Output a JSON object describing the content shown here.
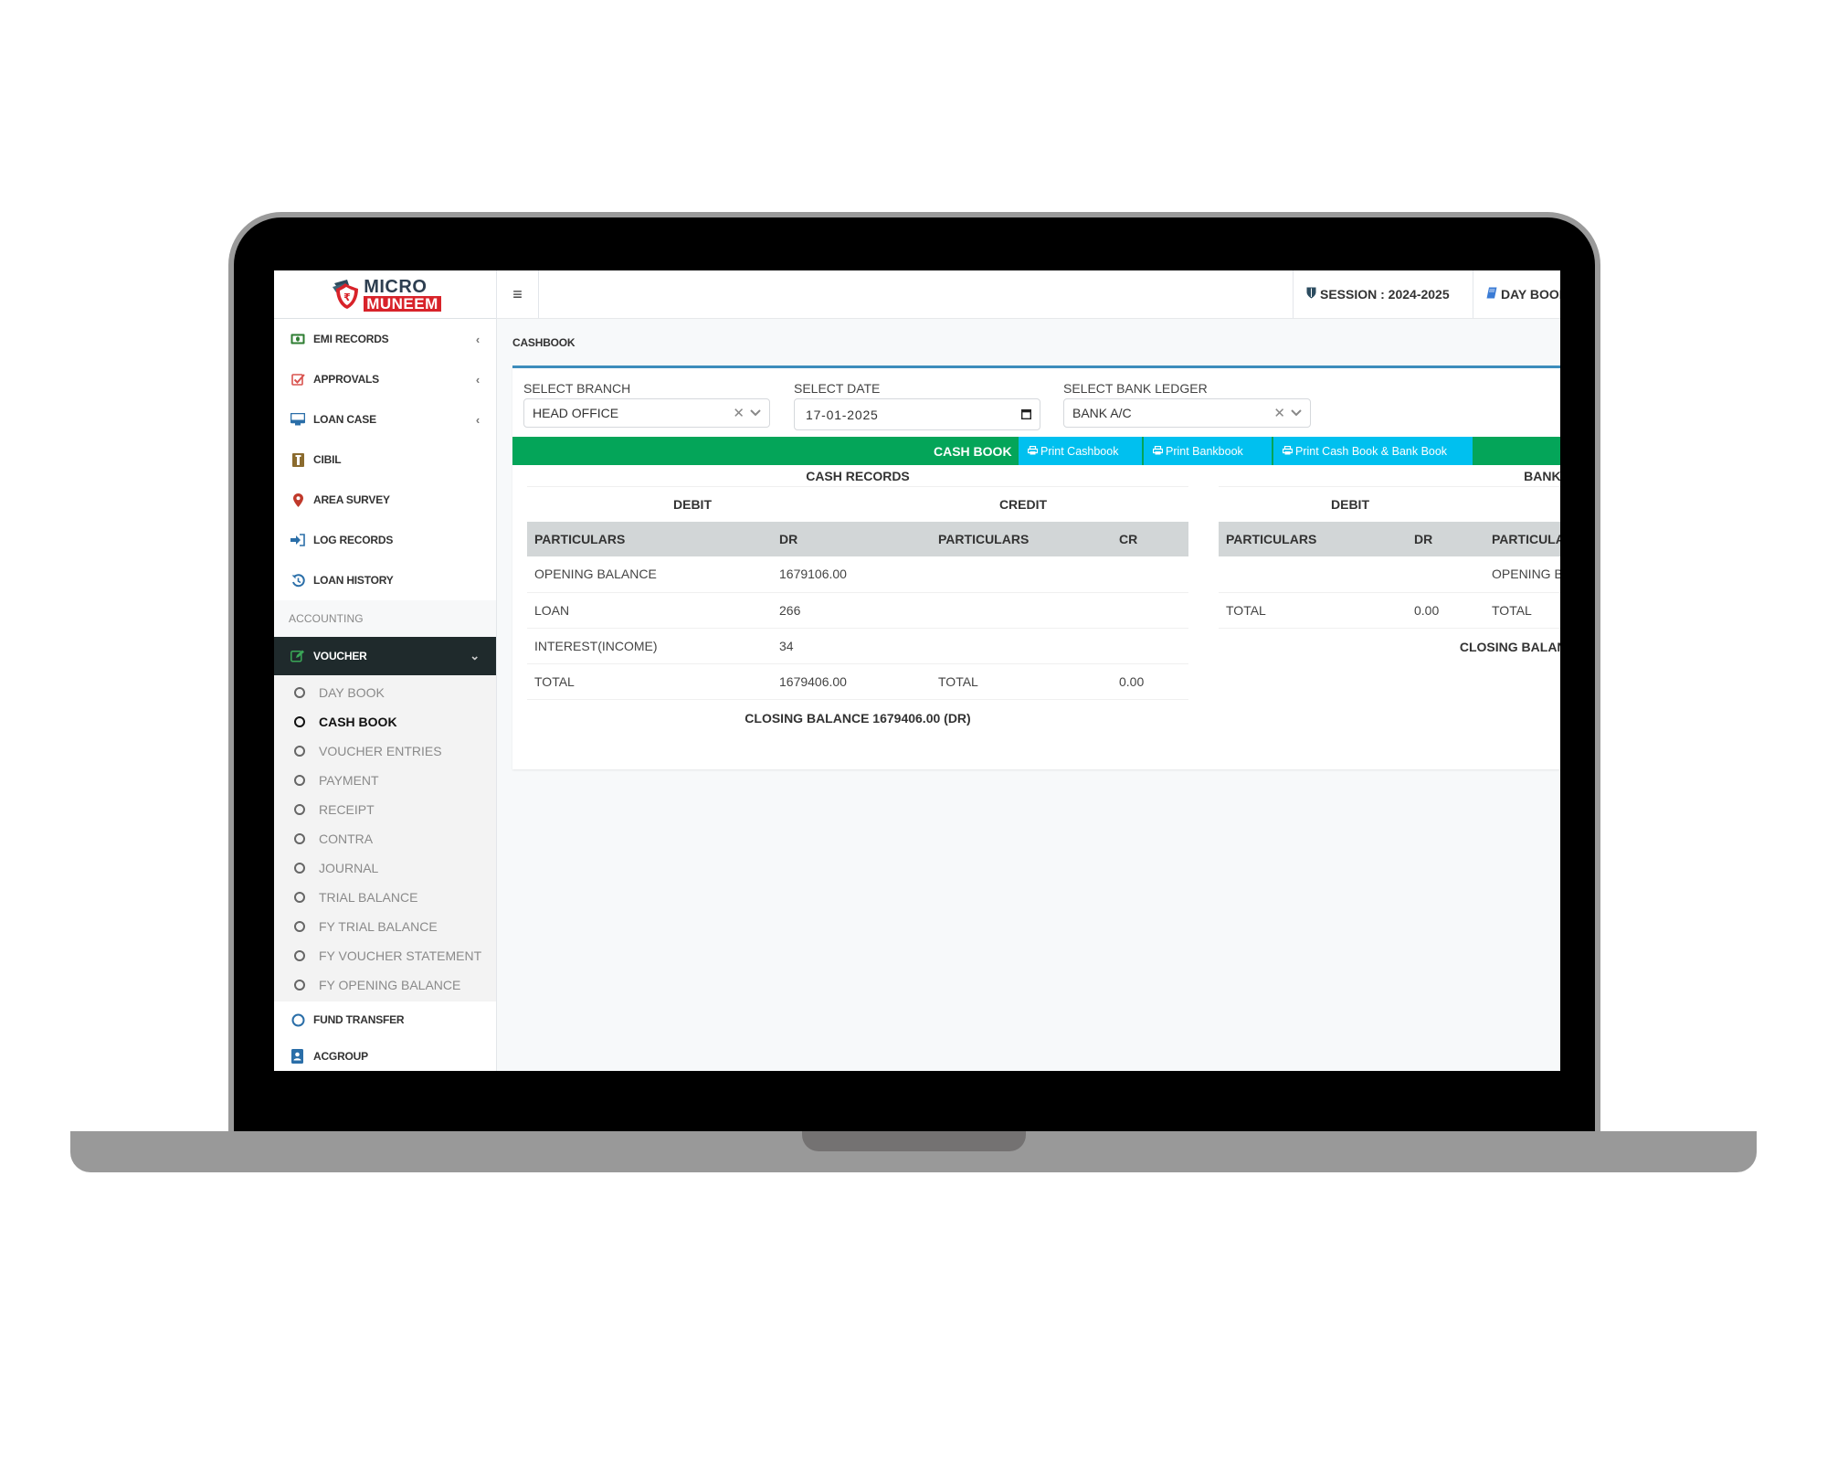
{
  "app": {
    "logo_top": "MICRO",
    "logo_bottom": "MUNEEM"
  },
  "sidebar": {
    "items": [
      {
        "label": "EMI RECORDS",
        "icon": "money-icon",
        "chevron": "‹"
      },
      {
        "label": "APPROVALS",
        "icon": "checkbox-icon",
        "chevron": "‹"
      },
      {
        "label": "LOAN CASE",
        "icon": "monitor-icon",
        "chevron": "‹"
      },
      {
        "label": "CIBIL",
        "icon": "id-badge-icon",
        "chevron": ""
      },
      {
        "label": "AREA SURVEY",
        "icon": "map-marker-icon",
        "chevron": ""
      },
      {
        "label": "LOG RECORDS",
        "icon": "sign-in-icon",
        "chevron": ""
      },
      {
        "label": "LOAN HISTORY",
        "icon": "history-icon",
        "chevron": ""
      }
    ],
    "section_label": "ACCOUNTING",
    "active_group": {
      "label": "VOUCHER",
      "icon": "edit-icon",
      "chevron": "⌄"
    },
    "submenu": [
      {
        "label": "DAY BOOK",
        "current": false
      },
      {
        "label": "CASH BOOK",
        "current": true
      },
      {
        "label": "VOUCHER ENTRIES",
        "current": false
      },
      {
        "label": "PAYMENT",
        "current": false
      },
      {
        "label": "RECEIPT",
        "current": false
      },
      {
        "label": "CONTRA",
        "current": false
      },
      {
        "label": "JOURNAL",
        "current": false
      },
      {
        "label": "TRIAL BALANCE",
        "current": false
      },
      {
        "label": "FY TRIAL BALANCE",
        "current": false
      },
      {
        "label": "FY VOUCHER STATEMENT",
        "current": false
      },
      {
        "label": "FY OPENING BALANCE",
        "current": false
      }
    ],
    "after_items": [
      {
        "label": "FUND TRANSFER",
        "icon": "circle-icon"
      },
      {
        "label": "ACGROUP",
        "icon": "address-book-icon"
      }
    ]
  },
  "header": {
    "menu_icon": "≡",
    "session_label": "SESSION : 2024-2025",
    "daybook_label": "DAY BOOK"
  },
  "page": {
    "breadcrumb": "CASHBOOK"
  },
  "filters": {
    "branch": {
      "label": "SELECT BRANCH",
      "value": "HEAD OFFICE"
    },
    "date": {
      "label": "SELECT DATE",
      "value": "17-01-2025"
    },
    "bank_ledger": {
      "label": "SELECT BANK LEDGER",
      "value": "BANK A/C"
    }
  },
  "toolbar": {
    "title": "CASH BOOK",
    "print_cashbook": "Print Cashbook",
    "print_bankbook": "Print Bankbook",
    "print_both": "Print Cash Book & Bank Book"
  },
  "colors": {
    "accent_green": "#04a559",
    "button_cyan": "#00c0ef",
    "card_border_blue": "#3c8dbc",
    "sidebar_active": "#1f2a2c",
    "brand_red": "#d8232a"
  },
  "cash_records": {
    "title": "CASH RECORDS",
    "debit_label": "DEBIT",
    "credit_label": "CREDIT",
    "columns": [
      "PARTICULARS",
      "DR",
      "PARTICULARS",
      "CR"
    ],
    "rows": [
      [
        "OPENING BALANCE",
        "1679106.00",
        "",
        ""
      ],
      [
        "LOAN",
        "266",
        "",
        ""
      ],
      [
        "INTEREST(INCOME)",
        "34",
        "",
        ""
      ],
      [
        "TOTAL",
        "1679406.00",
        "TOTAL",
        "0.00"
      ]
    ],
    "closing": "CLOSING BALANCE 1679406.00 (DR)"
  },
  "bank_records": {
    "title": "BANK REC",
    "debit_label": "DEBIT",
    "columns": [
      "PARTICULARS",
      "DR",
      "PARTICULAI"
    ],
    "rows": [
      [
        "",
        "",
        "OPENING BA"
      ],
      [
        "TOTAL",
        "0.00",
        "TOTAL"
      ]
    ],
    "closing": "CLOSING BALANCE"
  }
}
